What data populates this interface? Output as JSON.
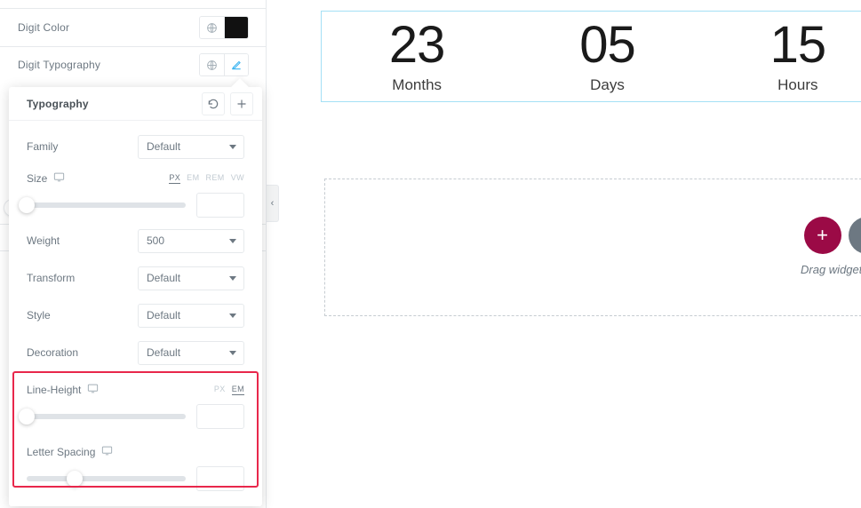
{
  "editor_panel": {
    "rows": [
      {
        "label": "Digit Color",
        "icons": [
          "globe-icon",
          "color-swatch"
        ],
        "swatch_color": "#111111"
      },
      {
        "label": "Digit Typography",
        "icons": [
          "globe-icon",
          "pencil-icon"
        ]
      }
    ],
    "collapse_arrow": "‹"
  },
  "typography_popover": {
    "title": "Typography",
    "reset_icon": "reset-icon",
    "add_icon": "plus-icon",
    "fields": [
      {
        "name": "family",
        "label": "Family",
        "value": "Default"
      },
      {
        "name": "weight",
        "label": "Weight",
        "value": "500"
      },
      {
        "name": "transform",
        "label": "Transform",
        "value": "Default"
      },
      {
        "name": "style",
        "label": "Style",
        "value": "Default"
      },
      {
        "name": "decoration",
        "label": "Decoration",
        "value": "Default"
      }
    ],
    "size": {
      "label": "Size",
      "responsive_icon": "desktop-icon",
      "units": [
        "PX",
        "EM",
        "REM",
        "VW"
      ],
      "active_unit": "PX",
      "value": "",
      "placeholder": "",
      "knob_percent": 0
    },
    "line_height": {
      "label": "Line-Height",
      "responsive_icon": "desktop-icon",
      "units": [
        "PX",
        "EM"
      ],
      "active_unit": "EM",
      "value": "",
      "placeholder": "",
      "knob_percent": 0
    },
    "letter_spacing": {
      "label": "Letter Spacing",
      "responsive_icon": "desktop-icon",
      "value": "",
      "placeholder": "",
      "knob_percent": 30
    }
  },
  "highlight": {
    "color": "#e8274b"
  },
  "canvas": {
    "countdown": {
      "cells": [
        {
          "digit": "23",
          "label": "Months"
        },
        {
          "digit": "05",
          "label": "Days"
        },
        {
          "digit": "15",
          "label": "Hours"
        }
      ],
      "selection_color": "#a4e0f5"
    },
    "dropzone": {
      "hint": "Drag widget here",
      "add_label": "+",
      "add_color": "#9b0a46",
      "folder_color": "#6d7882"
    }
  }
}
